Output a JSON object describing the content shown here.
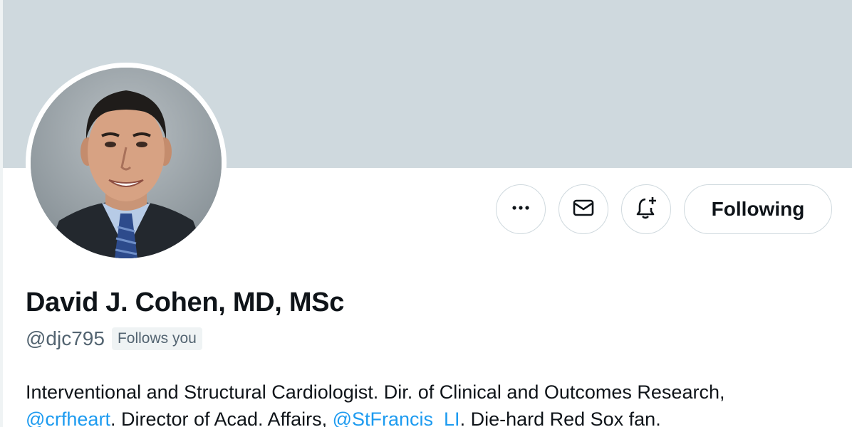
{
  "profile": {
    "display_name": "David J. Cohen, MD, MSc",
    "handle": "@djc795",
    "follows_you_badge": "Follows you",
    "avatar_icon": "profile-photo"
  },
  "actions": {
    "more_icon": "more-horizontal-icon",
    "message_icon": "envelope-icon",
    "notify_icon": "bell-plus-icon",
    "following_label": "Following"
  },
  "bio": {
    "line1": "Interventional and Structural Cardiologist.  Dir. of Clinical and Outcomes Research,",
    "line2": {
      "mention1": "@crfheart",
      "text1": ".  Director of Acad. Affairs, ",
      "mention2": "@StFrancis_LI",
      "text2": ". Die-hard Red Sox fan."
    }
  },
  "colors": {
    "banner": "#cfd9de",
    "link": "#1d9bf0",
    "text_primary": "#0f1419",
    "text_secondary": "#536471",
    "button_border": "#cfd9de"
  }
}
